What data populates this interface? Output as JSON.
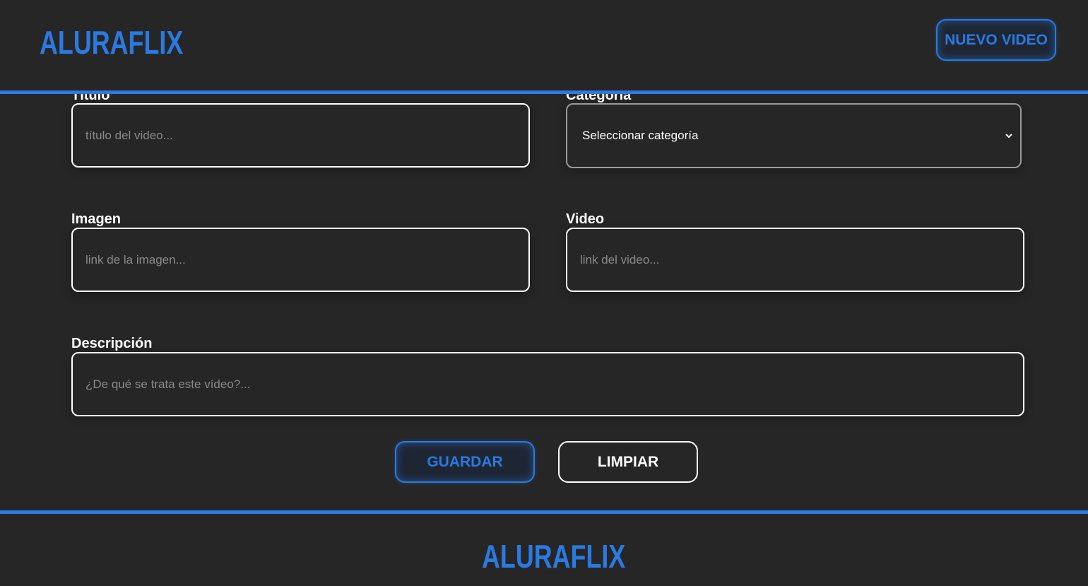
{
  "header": {
    "logo": "ALURAFLIX",
    "new_video_button": "NUEVO VIDEO"
  },
  "form": {
    "titulo": {
      "label": "Título",
      "placeholder": "título del video..."
    },
    "categoria": {
      "label": "Categoría",
      "selected": "Seleccionar categoría"
    },
    "imagen": {
      "label": "Imagen",
      "placeholder": "link de la imagen..."
    },
    "video": {
      "label": "Video",
      "placeholder": "link del video..."
    },
    "descripcion": {
      "label": "Descripción",
      "placeholder": "¿De qué se trata este vídeo?..."
    },
    "save_button": "GUARDAR",
    "clear_button": "LIMPIAR"
  },
  "footer": {
    "logo": "ALURAFLIX"
  },
  "colors": {
    "accent": "#2a7ae2",
    "background": "#262626",
    "text": "#ffffff"
  }
}
